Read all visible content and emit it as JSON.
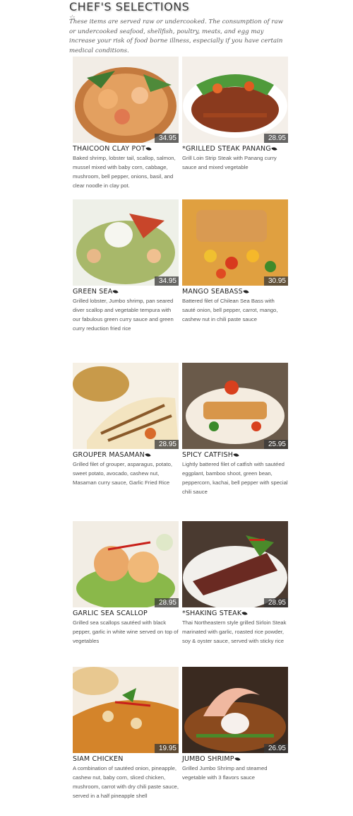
{
  "header": {
    "title": "CHEF'S SELECTIONS",
    "star": "☆",
    "disclaimer": "These items are served raw or undercooked. The consumption of raw or undercooked seafood, shellfish, poultry, meats, and egg may increase your risk of food borne illness, especially if you have certain medical conditions."
  },
  "items": [
    {
      "name": "THAICOON CLAY POT",
      "price": "34.95",
      "desc": "Baked shrimp, lobster tail, scallop, salmon, mussel mixed with baby corn, cabbage, mushroom, bell pepper, onions, basil, and clear noodle in clay pot.",
      "bg": "#d9a57a"
    },
    {
      "name": "*GRILLED STEAK PANANG",
      "price": "28.95",
      "desc": "Grill Loin Strip Steak with Panang curry sauce and mixed vegetable",
      "bg": "#7a3c22"
    },
    {
      "name": "GREEN SEA",
      "price": "34.95",
      "desc": "Grilled lobster, Jumbo shrimp, pan seared diver scallop and vegetable tempura with our fabulous green curry sauce and green curry reduction fried rice",
      "bg": "#a7b37a"
    },
    {
      "name": "MANGO SEABASS",
      "price": "30.95",
      "desc": "Battered filet of Chilean Sea Bass with sauté onion, bell pepper, carrot, mango, cashew nut in chili paste sauce",
      "bg": "#d88a2e"
    },
    {
      "name": "GROUPER MASAMAN",
      "price": "28.95",
      "desc": "Grilled filet of grouper, asparagus, potato, sweet potato, avocado, cashew nut, Masaman curry sauce, Garlic Fried Rice",
      "bg": "#e7c98a"
    },
    {
      "name": "SPICY CATFISH",
      "price": "25.95",
      "desc": "Lightly battered filet of catfish with sautéed eggplant, bamboo shoot, green bean, peppercorn, kachai, bell pepper with special chili sauce",
      "bg": "#8a6a3e"
    },
    {
      "name": "GARLIC SEA SCALLOP",
      "price": "28.95",
      "desc": "Grilled sea scallops sautéed with black pepper, garlic in white wine served on top of vegetables",
      "bg": "#e8a56a"
    },
    {
      "name": "*SHAKING STEAK",
      "price": "28.95",
      "desc": "Thai Northeastern style grilled Sirloin Steak marinated with garlic, roasted rice powder, soy & oyster sauce, served with sticky rice",
      "bg": "#5b2e22"
    },
    {
      "name": "SIAM CHICKEN",
      "price": "19.95",
      "desc": "A combination of sautéed onion, pineapple, cashew nut, baby corn, sliced chicken, mushroom, carrot with dry chili paste sauce, served in a half pineapple shell",
      "bg": "#d9862a"
    },
    {
      "name": "JUMBO SHRIMP",
      "price": "26.95",
      "desc": "Grilled Jumbo Shrimp and steamed vegetable with 3 flavors sauce",
      "bg": "#8a4a26"
    }
  ]
}
